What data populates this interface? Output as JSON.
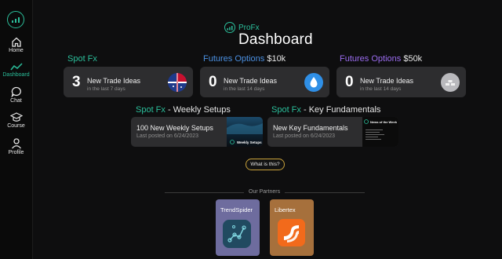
{
  "sidebar": {
    "items": [
      {
        "label": "Home",
        "icon": "home-icon"
      },
      {
        "label": "Dashboard",
        "icon": "chart-line-icon",
        "active": true
      },
      {
        "label": "Chat",
        "icon": "chat-bubble-icon"
      },
      {
        "label": "Course",
        "icon": "graduation-cap-icon"
      },
      {
        "label": "Profile",
        "icon": "user-icon"
      }
    ]
  },
  "header": {
    "brand": "ProFx",
    "title": "Dashboard"
  },
  "sections": {
    "spot_fx": "Spot Fx",
    "futures_a_label": "Futures Options",
    "futures_a_amount": "$10k",
    "futures_b_label": "Futures Options",
    "futures_b_amount": "$50k"
  },
  "trade_cards": [
    {
      "count": "3",
      "title": "New Trade Ideas",
      "subtitle": "in the last 7 days",
      "icon": "flags-icon"
    },
    {
      "count": "0",
      "title": "New Trade Ideas",
      "subtitle": "in the last 14 days",
      "icon": "drop-icon"
    },
    {
      "count": "0",
      "title": "New Trade Ideas",
      "subtitle": "in the last 14 days",
      "icon": "gold-bars-icon"
    }
  ],
  "weekly": {
    "heading_prefix": "Spot Fx",
    "heading_suffix": "- Weekly Setups",
    "title": "100 New Weekly Setups",
    "posted": "Last posted on 6/24/2023",
    "thumb_caption": "Weekly Setups"
  },
  "fundamentals": {
    "heading_prefix": "Spot Fx",
    "heading_suffix": "- Key Fundamentals",
    "title": "New Key Fundamentals",
    "posted": "Last posted on 6/24/2023",
    "thumb_caption": "News of the Week"
  },
  "what_button": "What is this?",
  "partners": {
    "label": "Our Partners",
    "items": [
      {
        "name": "TrendSpider",
        "color": "#6e6c9e"
      },
      {
        "name": "Libertex",
        "color": "#a6703c"
      }
    ]
  },
  "colors": {
    "accent": "#2bbf9b",
    "blue": "#4b90e2",
    "purple": "#9b6cf0",
    "card": "#2d2d2f"
  }
}
